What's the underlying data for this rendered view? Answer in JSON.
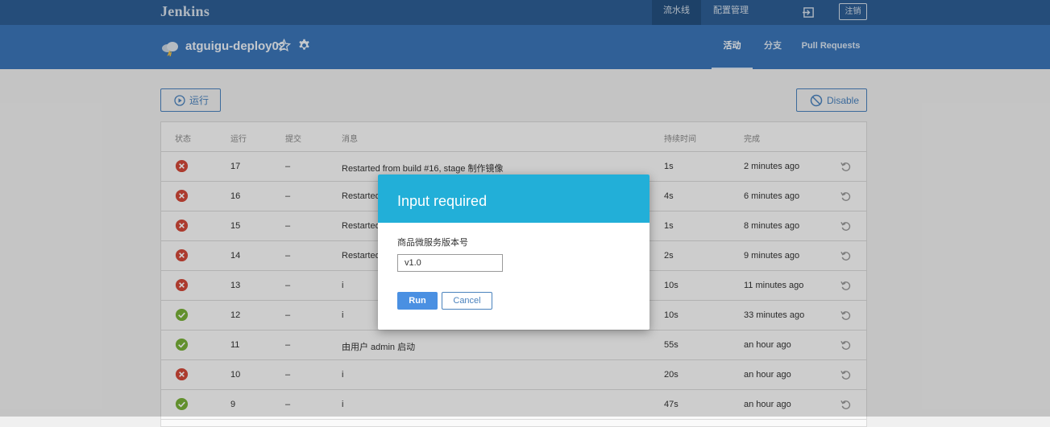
{
  "header": {
    "logo": "Jenkins",
    "nav": [
      {
        "label": "流水线",
        "active": true
      },
      {
        "label": "配置管理",
        "active": false
      }
    ],
    "logout_label": "注销"
  },
  "job": {
    "name": "atguigu-deploy02",
    "weather_icon": "weather-cloudy-icon",
    "tabs": [
      {
        "label": "活动",
        "active": true
      },
      {
        "label": "分支",
        "active": false
      },
      {
        "label": "Pull Requests",
        "active": false
      }
    ]
  },
  "toolbar": {
    "run_label": "运行",
    "disable_label": "Disable"
  },
  "table": {
    "headers": [
      "状态",
      "运行",
      "提交",
      "消息",
      "持续时间",
      "完成"
    ],
    "rows": [
      {
        "status": "failed",
        "run": "17",
        "commit": "–",
        "message": "Restarted from build #16, stage 制作镜像",
        "duration": "1s",
        "completed": "2 minutes ago"
      },
      {
        "status": "failed",
        "run": "16",
        "commit": "–",
        "message": "Restarted",
        "duration": "4s",
        "completed": "6 minutes ago"
      },
      {
        "status": "failed",
        "run": "15",
        "commit": "–",
        "message": "Restarted",
        "duration": "1s",
        "completed": "8 minutes ago"
      },
      {
        "status": "failed",
        "run": "14",
        "commit": "–",
        "message": "Restarted",
        "duration": "2s",
        "completed": "9 minutes ago"
      },
      {
        "status": "failed",
        "run": "13",
        "commit": "–",
        "message": "i",
        "duration": "10s",
        "completed": "11 minutes ago"
      },
      {
        "status": "success",
        "run": "12",
        "commit": "–",
        "message": "i",
        "duration": "10s",
        "completed": "33 minutes ago"
      },
      {
        "status": "success",
        "run": "11",
        "commit": "–",
        "message": "由用户 admin 启动",
        "duration": "55s",
        "completed": "an hour ago"
      },
      {
        "status": "failed",
        "run": "10",
        "commit": "–",
        "message": "i",
        "duration": "20s",
        "completed": "an hour ago"
      },
      {
        "status": "success",
        "run": "9",
        "commit": "–",
        "message": "i",
        "duration": "47s",
        "completed": "an hour ago"
      }
    ]
  },
  "modal": {
    "title": "Input required",
    "field_label": "商品微服务版本号",
    "field_value": "v1.0",
    "run_label": "Run",
    "cancel_label": "Cancel"
  },
  "colors": {
    "topbar": "#2e5f95",
    "subheader": "#3b76b9",
    "modal_header": "#22afd8",
    "failed": "#d24939",
    "success": "#78b037",
    "primary": "#4a90e2"
  }
}
